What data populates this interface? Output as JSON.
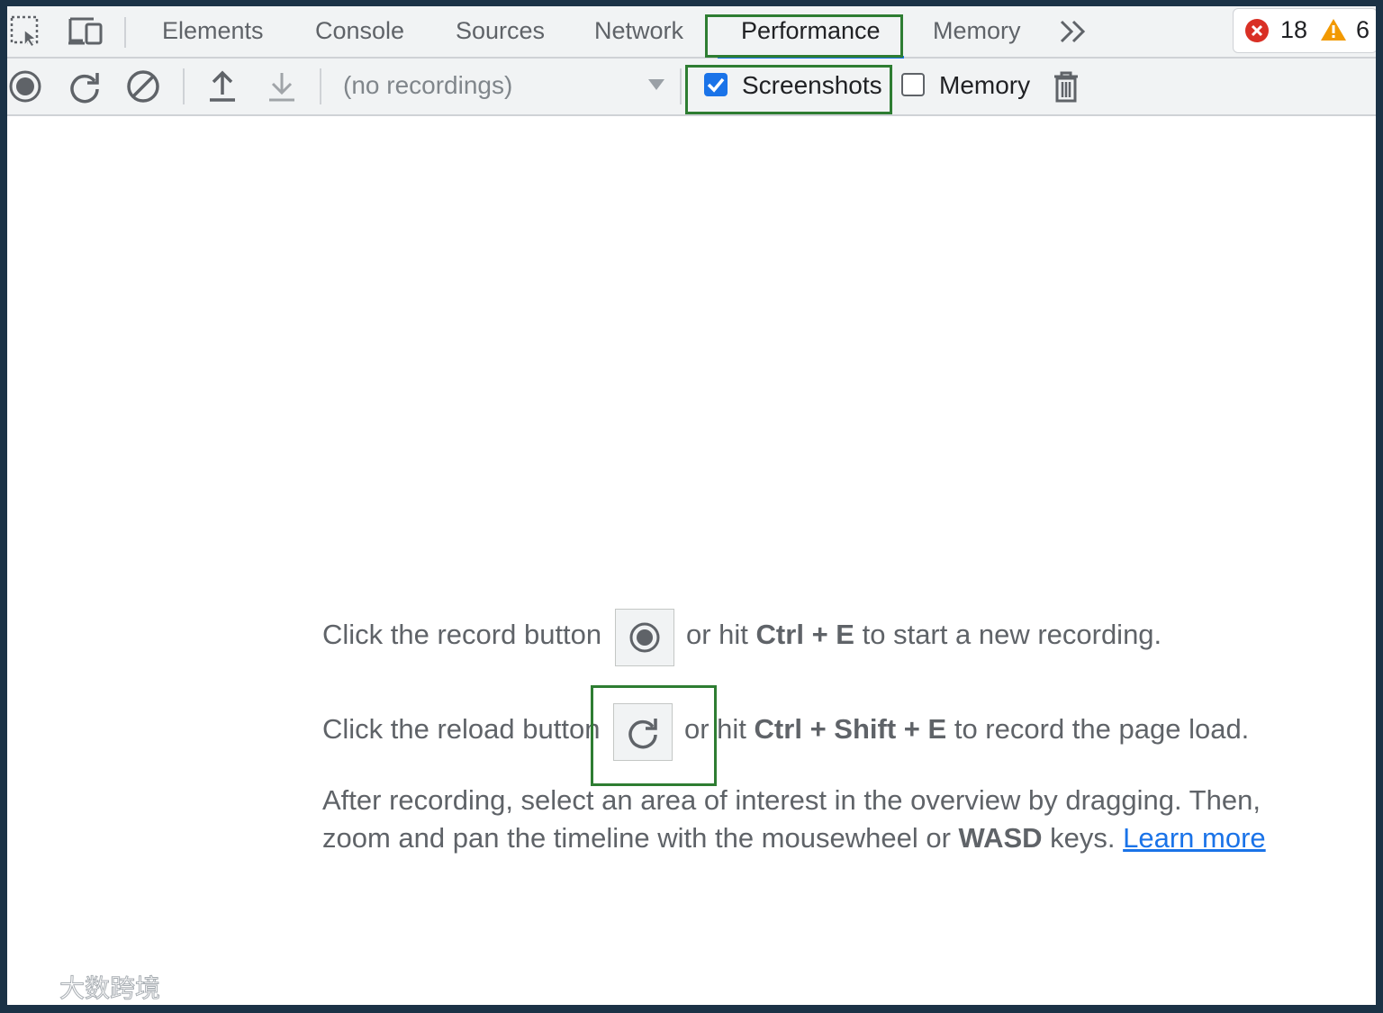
{
  "tabs": {
    "items": [
      "Elements",
      "Console",
      "Sources",
      "Network",
      "Performance",
      "Memory"
    ],
    "active": "Performance",
    "more_icon": "chevron-double-right-icon"
  },
  "issues": {
    "errors": "18",
    "warnings": "6",
    "error_color": "#d93025",
    "warning_color": "#f29900"
  },
  "toolbar": {
    "recordings_placeholder": "(no recordings)",
    "screenshots_label": "Screenshots",
    "screenshots_checked": true,
    "memory_label": "Memory",
    "memory_checked": false
  },
  "landing": {
    "line1_a": "Click the record button",
    "line1_b": "or hit",
    "line1_key1": "Ctrl",
    "plus": "+",
    "line1_key2": "E",
    "line1_c": "to start a new recording.",
    "line2_a": "Click the reload button",
    "line2_b": "or hit",
    "line2_key1": "Ctrl",
    "line2_key2": "Shift",
    "line2_key3": "E",
    "line2_c": "to record the page load.",
    "line3": "After recording, select an area of interest in the overview by dragging. Then,",
    "line4_a": "zoom and pan the timeline with the mousewheel or",
    "line4_key": "WASD",
    "line4_b": "keys.",
    "learn_more": "Learn more"
  },
  "watermark": {
    "text": "大数跨境"
  },
  "colors": {
    "accent": "#1a73e8",
    "highlight": "#2e7d32",
    "background": "#1b3246"
  }
}
